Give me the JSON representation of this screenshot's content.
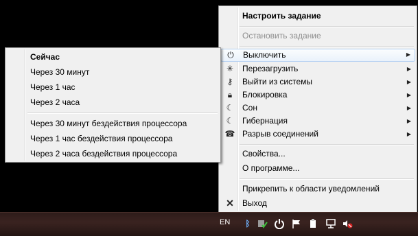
{
  "main_menu": {
    "items": [
      {
        "label": "Настроить задание"
      },
      {
        "label": "Остановить задание"
      },
      {
        "label": "Выключить",
        "icon": "power-icon"
      },
      {
        "label": "Перезагрузить",
        "icon": "restart-icon"
      },
      {
        "label": "Выйти из системы",
        "icon": "key-icon"
      },
      {
        "label": "Блокировка",
        "icon": "lock-icon"
      },
      {
        "label": "Сон",
        "icon": "moon-icon"
      },
      {
        "label": "Гибернация",
        "icon": "moon-icon"
      },
      {
        "label": "Разрыв соединений",
        "icon": "phone-icon"
      },
      {
        "label": "Свойства..."
      },
      {
        "label": "О программе..."
      },
      {
        "label": "Прикрепить к области уведомлений"
      },
      {
        "label": "Выход",
        "icon": "close-icon"
      }
    ]
  },
  "sub_menu": {
    "items": [
      {
        "label": "Сейчас"
      },
      {
        "label": "Через 30 минут"
      },
      {
        "label": "Через 1 час"
      },
      {
        "label": "Через 2 часа"
      },
      {
        "label": "Через 30 минут бездействия процессора"
      },
      {
        "label": "Через 1 час бездействия процессора"
      },
      {
        "label": "Через 2 часа бездействия процессора"
      }
    ]
  },
  "taskbar": {
    "language": "EN",
    "tray_icons": [
      "bluetooth-icon",
      "shield-check-icon",
      "power-icon",
      "flag-icon",
      "usb-icon",
      "network-icon",
      "volume-muted-icon"
    ]
  }
}
